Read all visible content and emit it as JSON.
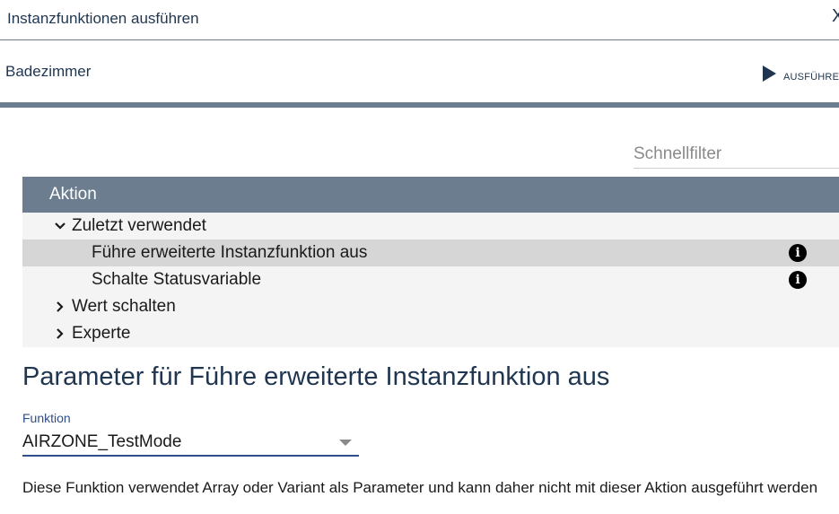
{
  "dialog": {
    "title": "Instanzfunktionen ausführen",
    "close_glyph": "X"
  },
  "instance": {
    "name": "Badezimmer"
  },
  "run_button": {
    "label": "AUSFÜHRE"
  },
  "filter": {
    "placeholder": "Schnellfilter",
    "value": ""
  },
  "actions_table": {
    "header": "Aktion",
    "groups": [
      {
        "label": "Zuletzt verwendet",
        "expanded": true,
        "items": [
          {
            "label": "Führe erweiterte Instanzfunktion aus",
            "selected": true,
            "info_icon": "info-icon"
          },
          {
            "label": "Schalte Statusvariable",
            "selected": false,
            "info_icon": "info-icon"
          }
        ]
      },
      {
        "label": "Wert schalten",
        "expanded": false,
        "items": []
      },
      {
        "label": "Experte",
        "expanded": false,
        "items": []
      }
    ]
  },
  "parameters": {
    "title": "Parameter für Führe erweiterte Instanzfunktion aus",
    "function_field": {
      "label": "Funktion",
      "value": "AIRZONE_TestMode"
    },
    "note": "Diese Funktion verwendet Array oder Variant als Parameter und kann daher nicht mit dieser Aktion ausgeführt werden"
  },
  "colors": {
    "header_bg": "#6b7d8f",
    "selected_row": "#d6d6d6",
    "row_bg": "#f4f4f4",
    "accent": "#2f4f8a",
    "title": "#1f3550"
  }
}
